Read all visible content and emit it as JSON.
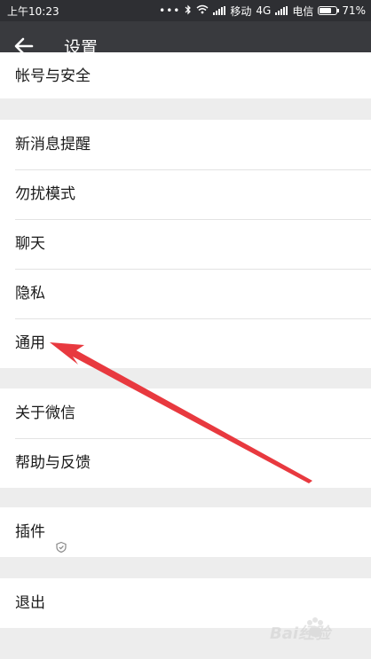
{
  "status_bar": {
    "time": "上午10:23",
    "dots": "•••",
    "carrier1": "移动",
    "network": "4G",
    "carrier2": "电信",
    "battery": "71%",
    "battery_level": 0.71
  },
  "app_bar": {
    "back_icon": "arrow-left-icon",
    "title": "设置"
  },
  "groups": [
    {
      "items": [
        "帐号与安全"
      ]
    },
    {
      "items": [
        "新消息提醒",
        "勿扰模式",
        "聊天",
        "隐私",
        "通用"
      ]
    },
    {
      "items": [
        "关于微信",
        "帮助与反馈"
      ]
    },
    {
      "items": [
        "插件"
      ]
    },
    {
      "items": [
        "退出"
      ]
    }
  ],
  "plugin_icon": "shield-icon",
  "annotation": {
    "arrow_color": "#e8393f"
  },
  "watermark": {
    "text": "Bai经验",
    "icon": "paw-icon"
  },
  "colors": {
    "status_bar_bg": "#2e2f33",
    "app_bar_bg": "#393a3e",
    "page_bg": "#ededed",
    "item_bg": "#ffffff"
  }
}
